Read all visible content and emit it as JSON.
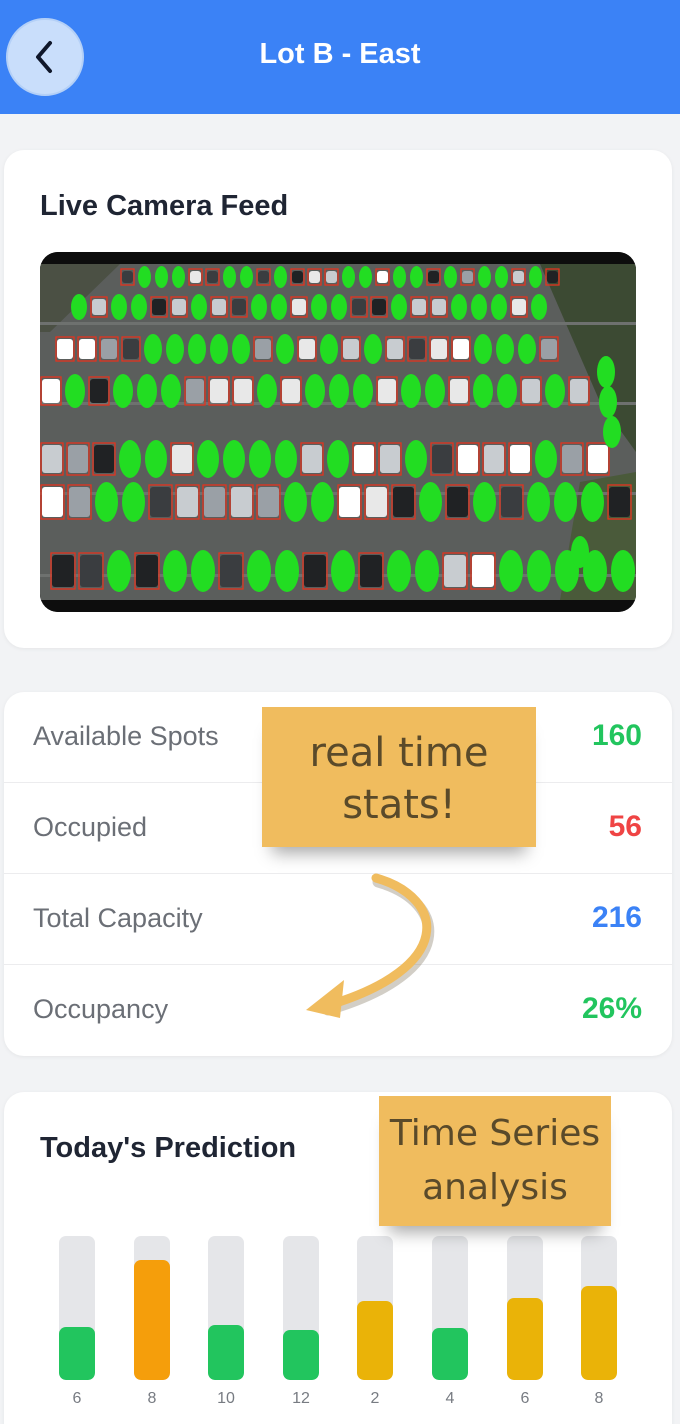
{
  "header": {
    "title": "Lot B - East",
    "back_icon": "chevron-left-icon",
    "color": "#3b82f6"
  },
  "feed": {
    "title": "Live Camera Feed"
  },
  "stats": [
    {
      "label": "Available Spots",
      "value": "160",
      "color": "#22c55e"
    },
    {
      "label": "Occupied",
      "value": "56",
      "color": "#ef4444"
    },
    {
      "label": "Total Capacity",
      "value": "216",
      "color": "#3b82f6"
    },
    {
      "label": "Occupancy",
      "value": "26%",
      "color": "#22c55e"
    }
  ],
  "annotations": {
    "stats_note": [
      "real time",
      "stats!"
    ],
    "series_note": [
      "Time Series",
      "analysis"
    ]
  },
  "prediction": {
    "title": "Today's Prediction",
    "bars": [
      {
        "label": "6",
        "level": 0.37,
        "color": "#22c55e"
      },
      {
        "label": "8",
        "level": 0.83,
        "color": "#f59e0b"
      },
      {
        "label": "10",
        "level": 0.38,
        "color": "#22c55e"
      },
      {
        "label": "12",
        "level": 0.35,
        "color": "#22c55e"
      },
      {
        "label": "2",
        "level": 0.55,
        "color": "#eab308"
      },
      {
        "label": "4",
        "level": 0.36,
        "color": "#22c55e"
      },
      {
        "label": "6",
        "level": 0.57,
        "color": "#eab308"
      },
      {
        "label": "8",
        "level": 0.65,
        "color": "#eab308"
      }
    ]
  }
}
